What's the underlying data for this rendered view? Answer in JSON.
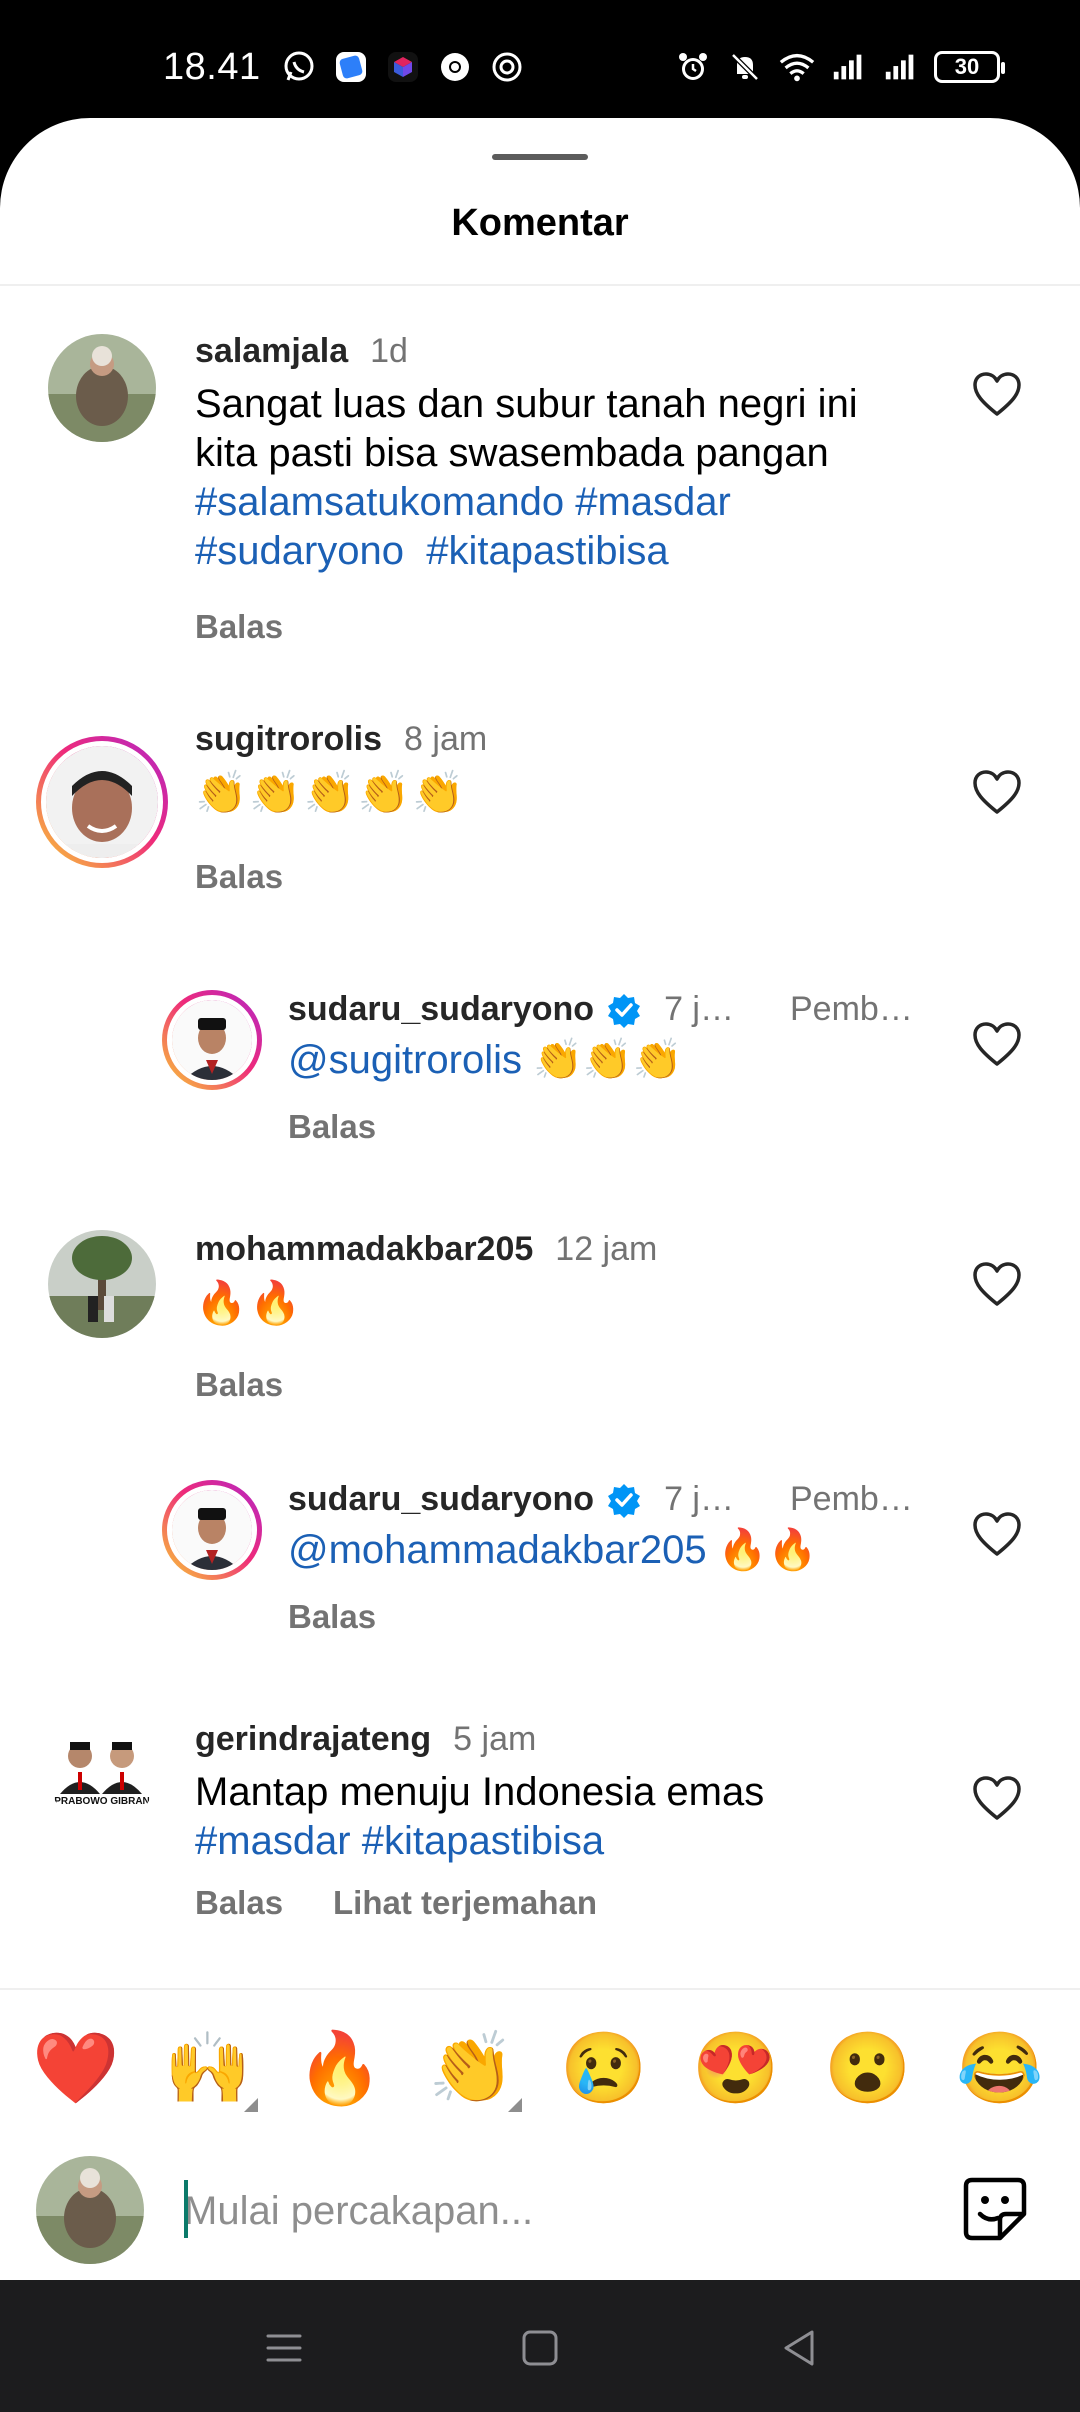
{
  "status_bar": {
    "time": "18.41",
    "battery": "30",
    "left_icons": [
      "whatsapp-icon",
      "app-icon-blue",
      "app-icon-cube",
      "chrome-icon",
      "threads-icon"
    ],
    "right_icons": [
      "alarm-icon",
      "mute-icon",
      "wifi-icon",
      "signal-icon",
      "signal-icon"
    ]
  },
  "sheet": {
    "title": "Komentar"
  },
  "comments": [
    {
      "username": "salamjala",
      "time": "1d",
      "text_lines": [
        [
          {
            "t": "Sangat luas dan subur tanah negri ini",
            "tag": false
          }
        ],
        [
          {
            "t": "kita pasti bisa swasembada pangan",
            "tag": false
          }
        ],
        [
          {
            "t": "#salamsatukomando #masdar",
            "tag": true
          }
        ],
        [
          {
            "t": "#sudaryono  #kitapastibisa",
            "tag": true
          }
        ]
      ],
      "reply_label": "Balas"
    },
    {
      "username": "sugitrorolis",
      "time": "8 jam",
      "text": "👏👏👏👏👏",
      "reply_label": "Balas"
    },
    {
      "username": "sudaru_sudaryono",
      "time": "7 j…",
      "pin": "Pemb…",
      "mention": "@sugitrorolis",
      "text": " 👏👏👏",
      "reply_label": "Balas"
    },
    {
      "username": "mohammadakbar205",
      "time": "12 jam",
      "text": "🔥🔥",
      "reply_label": "Balas"
    },
    {
      "username": "sudaru_sudaryono",
      "time": "7 j…",
      "pin": "Pemb…",
      "mention": "@mohammadakbar205",
      "text": " 🔥🔥",
      "reply_label": "Balas"
    },
    {
      "username": "gerindrajateng",
      "time": "5 jam",
      "text_line1": "Mantap menuju Indonesia emas",
      "text_line2": "#masdar #kitapastibisa",
      "reply_label": "Balas",
      "translate_label": "Lihat terjemahan",
      "avatar_caption": "PRABOWO GIBRAN"
    }
  ],
  "emoji_bar": [
    "❤️",
    "🙌",
    "🔥",
    "👏",
    "😢",
    "😍",
    "😮",
    "😂"
  ],
  "composer": {
    "placeholder": "Mulai percakapan..."
  },
  "colors": {
    "hashtag": "#1b60b5",
    "verified": "#0095f6",
    "muted": "#737373"
  }
}
